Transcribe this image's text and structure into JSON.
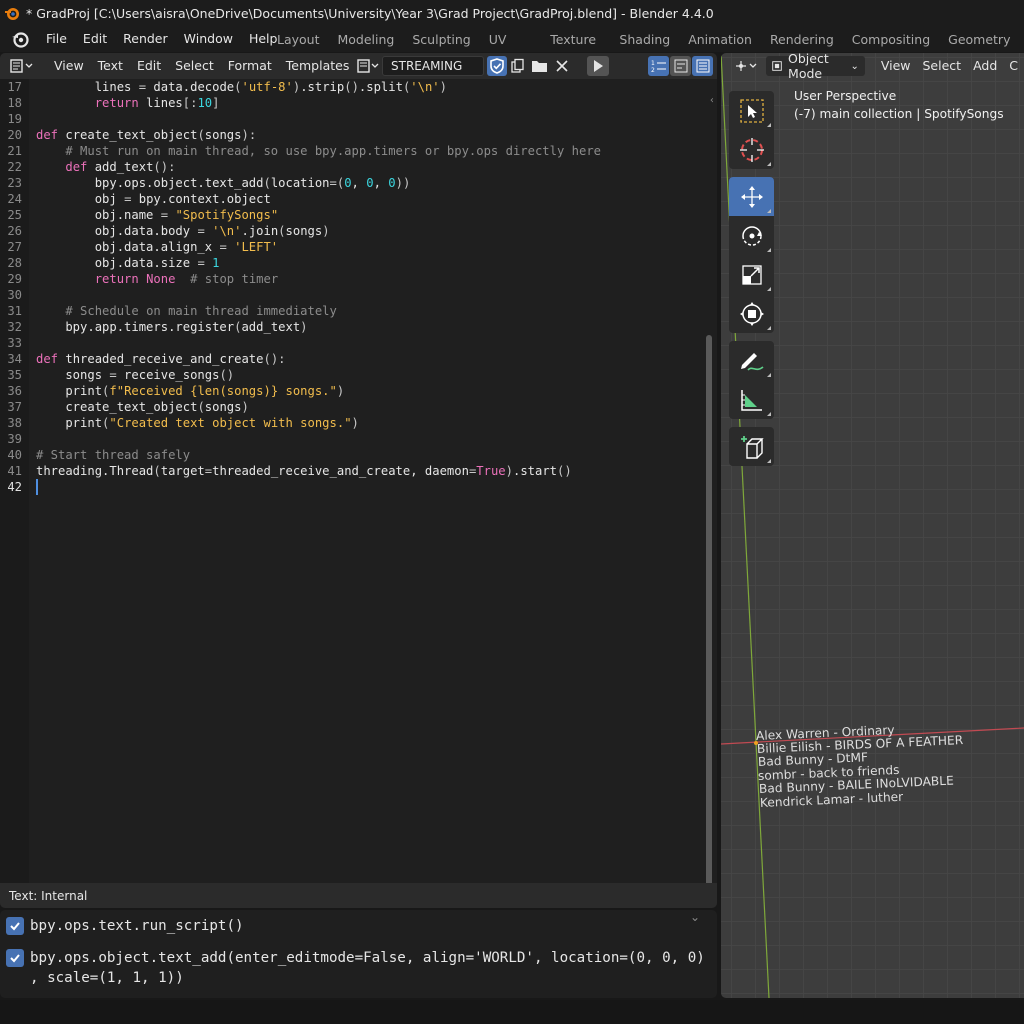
{
  "window": {
    "title": "* GradProj [C:\\Users\\aisra\\OneDrive\\Documents\\University\\Year 3\\Grad Project\\GradProj.blend] - Blender 4.4.0"
  },
  "menubar": {
    "items": [
      "File",
      "Edit",
      "Render",
      "Window",
      "Help"
    ],
    "workspaces": [
      "Layout",
      "Modeling",
      "Sculpting",
      "UV Editing",
      "Texture Paint",
      "Shading",
      "Animation",
      "Rendering",
      "Compositing",
      "Geometry Nodes"
    ]
  },
  "text_editor": {
    "menus": [
      "View",
      "Text",
      "Edit",
      "Select",
      "Format",
      "Templates"
    ],
    "text_name": "STREAMING",
    "footer": "Text: Internal",
    "current_line": "42",
    "lines": [
      {
        "n": "17",
        "src": "        lines = data.decode('utf-8').strip().split('\\n')"
      },
      {
        "n": "18",
        "src": "        return lines[:10]"
      },
      {
        "n": "19",
        "src": ""
      },
      {
        "n": "20",
        "src": "def create_text_object(songs):"
      },
      {
        "n": "21",
        "src": "    # Must run on main thread, so use bpy.app.timers or bpy.ops directly here"
      },
      {
        "n": "22",
        "src": "    def add_text():"
      },
      {
        "n": "23",
        "src": "        bpy.ops.object.text_add(location=(0, 0, 0))"
      },
      {
        "n": "24",
        "src": "        obj = bpy.context.object"
      },
      {
        "n": "25",
        "src": "        obj.name = \"SpotifySongs\""
      },
      {
        "n": "26",
        "src": "        obj.data.body = '\\n'.join(songs)"
      },
      {
        "n": "27",
        "src": "        obj.data.align_x = 'LEFT'"
      },
      {
        "n": "28",
        "src": "        obj.data.size = 1"
      },
      {
        "n": "29",
        "src": "        return None  # stop timer"
      },
      {
        "n": "30",
        "src": ""
      },
      {
        "n": "31",
        "src": "    # Schedule on main thread immediately"
      },
      {
        "n": "32",
        "src": "    bpy.app.timers.register(add_text)"
      },
      {
        "n": "33",
        "src": ""
      },
      {
        "n": "34",
        "src": "def threaded_receive_and_create():"
      },
      {
        "n": "35",
        "src": "    songs = receive_songs()"
      },
      {
        "n": "36",
        "src": "    print(f\"Received {len(songs)} songs.\")"
      },
      {
        "n": "37",
        "src": "    create_text_object(songs)"
      },
      {
        "n": "38",
        "src": "    print(\"Created text object with songs.\")"
      },
      {
        "n": "39",
        "src": ""
      },
      {
        "n": "40",
        "src": "# Start thread safely"
      },
      {
        "n": "41",
        "src": "threading.Thread(target=threaded_receive_and_create, daemon=True).start()"
      },
      {
        "n": "42",
        "src": ""
      }
    ]
  },
  "info_log": {
    "entries": [
      "bpy.ops.text.run_script()",
      "bpy.ops.object.text_add(enter_editmode=False, align='WORLD', location=(0, 0, 0)\n, scale=(1, 1, 1))"
    ]
  },
  "viewport": {
    "mode": "Object Mode",
    "menus": [
      "View",
      "Select",
      "Add",
      "C"
    ],
    "perspective": "User Perspective",
    "collection_info": "(-7) main collection | SpotifySongs",
    "songs": [
      "Alex Warren - Ordinary",
      "Billie Eilish - BIRDS OF A FEATHER",
      "Bad Bunny - DtMF",
      "sombr - back to friends",
      "Bad Bunny - BAILE INoLVIDABLE",
      "Kendrick Lamar - luther"
    ],
    "tools": [
      "select-box",
      "cursor",
      "move",
      "rotate",
      "scale",
      "transform",
      "annotate",
      "measure",
      "add-cube"
    ],
    "active_tool": "move"
  },
  "colors": {
    "accent": "#4772b3",
    "keyword": "#eb71ba",
    "string": "#f2bd4d",
    "number": "#3bd6df",
    "comment": "#8c8c8c",
    "axis_x": "#c14a52",
    "axis_y": "#7fa83a"
  }
}
